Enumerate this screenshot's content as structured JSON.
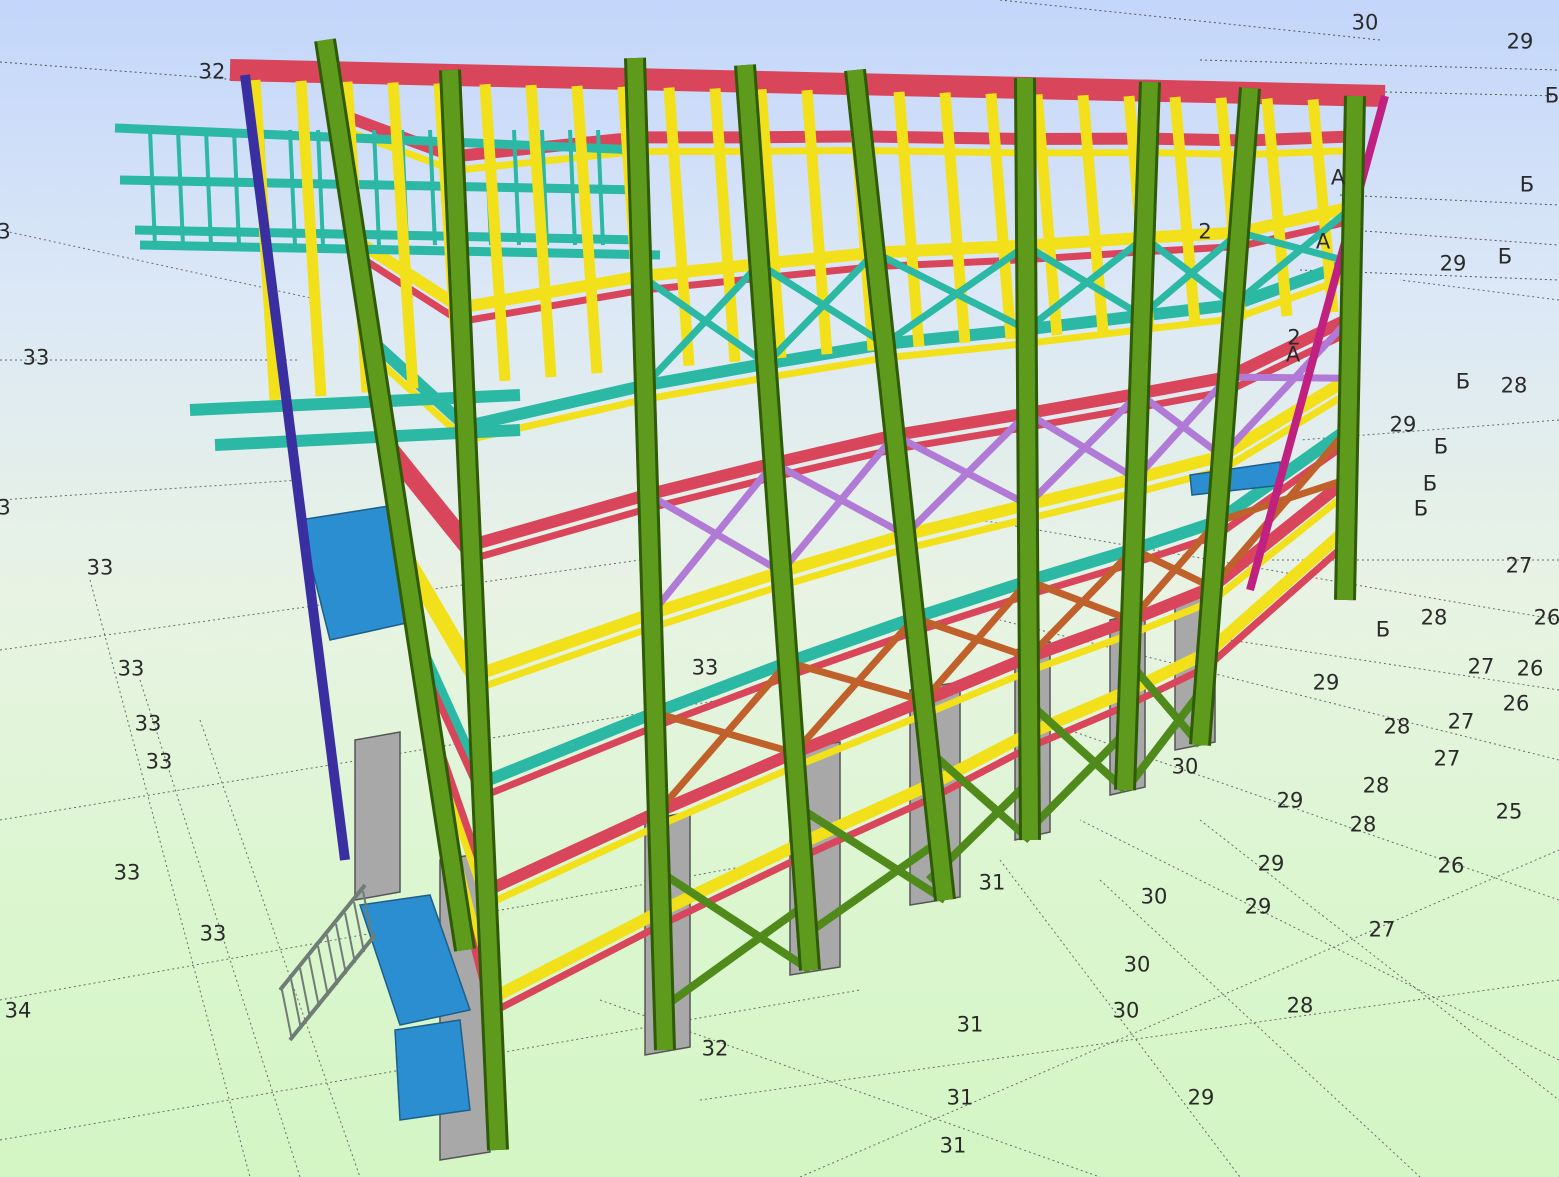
{
  "viewport": {
    "background_top": "#c3d6fb",
    "background_bottom": "#d3f6c4"
  },
  "model": {
    "colors": {
      "column": "#5e9a1c",
      "column_edge": "#2f5a06",
      "beam_red": "#d9455a",
      "beam_yellow": "#f2e01a",
      "railing_teal": "#2bb8a4",
      "bracing_purple": "#b07ad6",
      "bracing_orange": "#c0612b",
      "pedestal_gray": "#a8a8a8",
      "platform_blue": "#2a8ed0",
      "stair_gray": "#6f7d76",
      "magenta_column": "#c0207f",
      "navy_column": "#3a2fa0"
    }
  },
  "grid_labels": [
    {
      "text": "30"
    },
    {
      "text": "29"
    },
    {
      "text": "32"
    },
    {
      "text": "Б"
    },
    {
      "text": "3"
    },
    {
      "text": "А"
    },
    {
      "text": "Б"
    },
    {
      "text": "29"
    },
    {
      "text": "Б"
    },
    {
      "text": "33"
    },
    {
      "text": "А"
    },
    {
      "text": "Б"
    },
    {
      "text": "28"
    },
    {
      "text": "29"
    },
    {
      "text": "А"
    },
    {
      "text": "Б"
    },
    {
      "text": "Б"
    },
    {
      "text": "Б"
    },
    {
      "text": "3"
    },
    {
      "text": "33"
    },
    {
      "text": "27"
    },
    {
      "text": "Б"
    },
    {
      "text": "28"
    },
    {
      "text": "26"
    },
    {
      "text": "33"
    },
    {
      "text": "27"
    },
    {
      "text": "26"
    },
    {
      "text": "29"
    },
    {
      "text": "33"
    },
    {
      "text": "26"
    },
    {
      "text": "28"
    },
    {
      "text": "27"
    },
    {
      "text": "33"
    },
    {
      "text": "27"
    },
    {
      "text": "30"
    },
    {
      "text": "28"
    },
    {
      "text": "29"
    },
    {
      "text": "28"
    },
    {
      "text": "25"
    },
    {
      "text": "29"
    },
    {
      "text": "33"
    },
    {
      "text": "26"
    },
    {
      "text": "31"
    },
    {
      "text": "30"
    },
    {
      "text": "29"
    },
    {
      "text": "33"
    },
    {
      "text": "27"
    },
    {
      "text": "30"
    },
    {
      "text": "34"
    },
    {
      "text": "30"
    },
    {
      "text": "28"
    },
    {
      "text": "31"
    },
    {
      "text": "32"
    },
    {
      "text": "31"
    },
    {
      "text": "29"
    },
    {
      "text": "31"
    },
    {
      "text": "33"
    },
    {
      "text": "2"
    },
    {
      "text": "2"
    }
  ]
}
